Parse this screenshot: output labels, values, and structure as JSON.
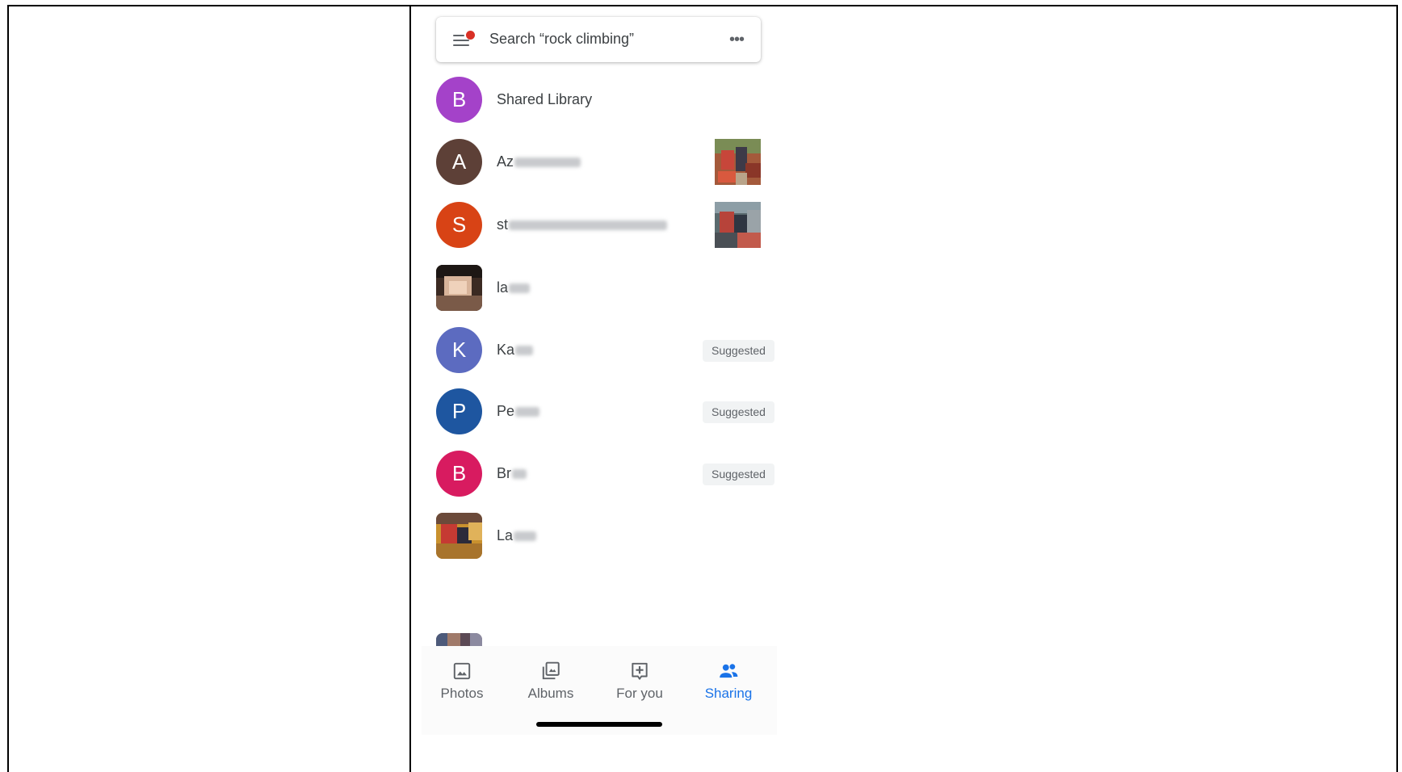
{
  "search": {
    "placeholder": "Search “rock climbing”",
    "menu_icon": "menu-icon",
    "more_icon": "more-horizontal-icon"
  },
  "sharing_list": [
    {
      "avatar_letter": "B",
      "avatar_color": "#a442c9",
      "name": "Shared Library",
      "blurred": false,
      "trailing": "none"
    },
    {
      "avatar_letter": "A",
      "avatar_color": "#5d4037",
      "name": "Az",
      "blurred": true,
      "trailing": "photo"
    },
    {
      "avatar_letter": "S",
      "avatar_color": "#d84315",
      "name": "st",
      "blurred": true,
      "trailing": "photo"
    },
    {
      "avatar_letter": "",
      "avatar_color": "",
      "name": "la",
      "blurred": true,
      "trailing": "none",
      "photo_avatar": true
    },
    {
      "avatar_letter": "K",
      "avatar_color": "#5c6bc0",
      "name": "Ka",
      "blurred": true,
      "trailing": "badge"
    },
    {
      "avatar_letter": "P",
      "avatar_color": "#1e56a0",
      "name": "Pe",
      "blurred": true,
      "trailing": "badge"
    },
    {
      "avatar_letter": "B",
      "avatar_color": "#d81b60",
      "name": "Br",
      "blurred": true,
      "trailing": "badge"
    },
    {
      "avatar_letter": "",
      "avatar_color": "",
      "name": "La",
      "blurred": true,
      "trailing": "none",
      "photo_avatar": true
    }
  ],
  "badge_label": "Suggested",
  "bottom_nav": [
    {
      "label": "Photos",
      "icon": "photo-icon",
      "active": false
    },
    {
      "label": "Albums",
      "icon": "albums-icon",
      "active": false
    },
    {
      "label": "For you",
      "icon": "for-you-icon",
      "active": false
    },
    {
      "label": "Sharing",
      "icon": "sharing-people-icon",
      "active": true
    }
  ],
  "colors": {
    "accent": "#1a73e8",
    "text": "#3c4043",
    "badge_bg": "#f1f3f4"
  }
}
